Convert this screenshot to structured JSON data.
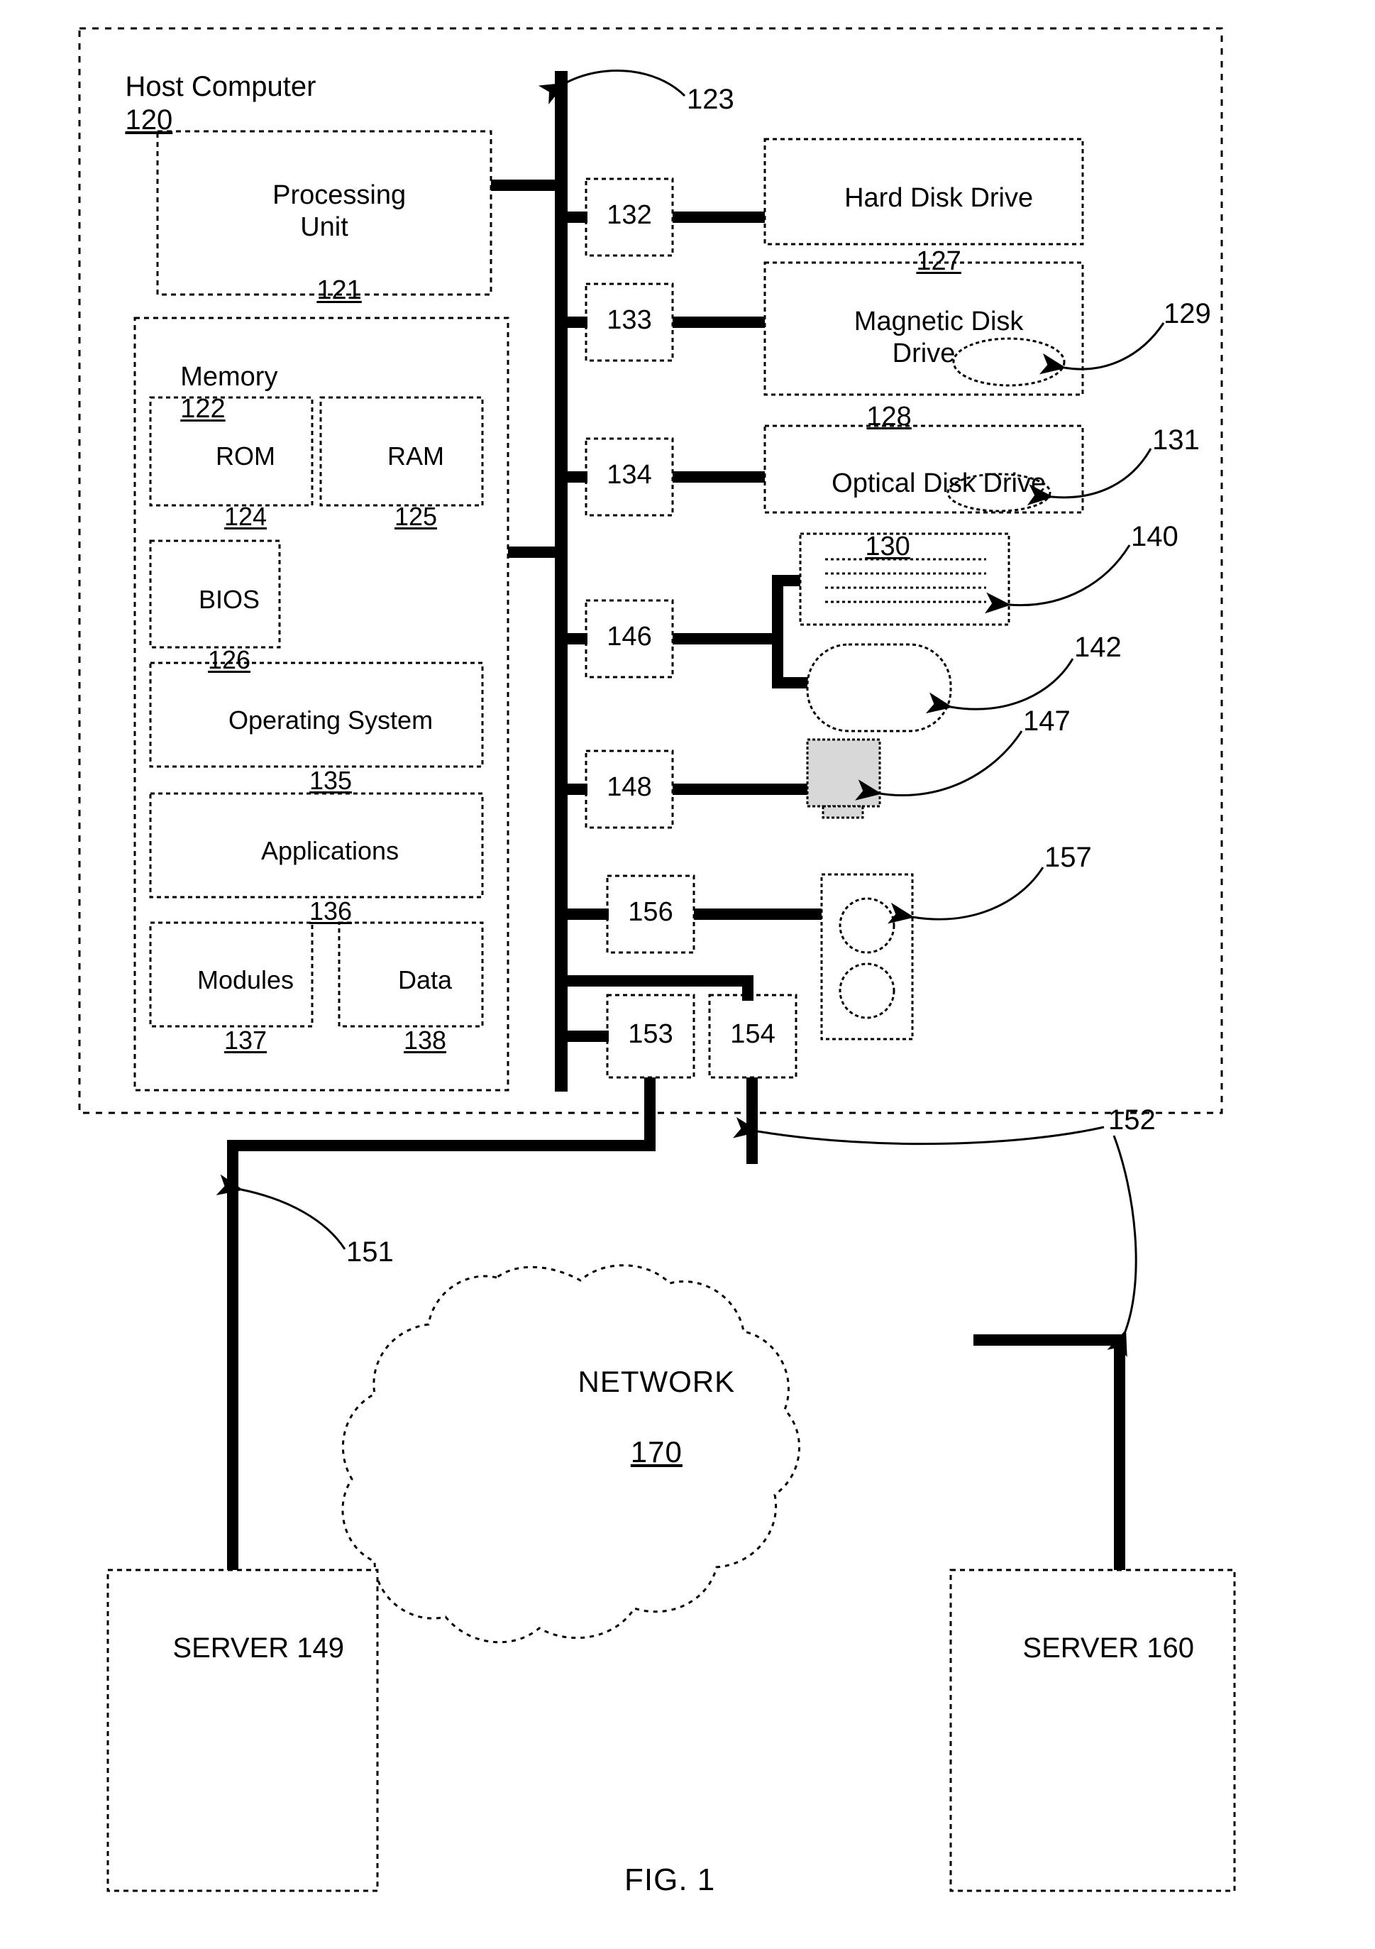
{
  "figure": {
    "caption": "FIG. 1",
    "host": {
      "title": "Host Computer",
      "ref": "120"
    },
    "blocks": {
      "processing_unit": {
        "label": "Processing\nUnit",
        "ref": "121"
      },
      "memory": {
        "label": "Memory",
        "ref": "122"
      },
      "rom": {
        "label": "ROM",
        "ref": "124"
      },
      "ram": {
        "label": "RAM",
        "ref": "125"
      },
      "bios": {
        "label": "BIOS",
        "ref": "126"
      },
      "operating_system": {
        "label": "Operating System",
        "ref": "135"
      },
      "applications": {
        "label": "Applications",
        "ref": "136"
      },
      "modules": {
        "label": "Modules",
        "ref": "137"
      },
      "data": {
        "label": "Data",
        "ref": "138"
      },
      "hard_disk_drive": {
        "label": "Hard Disk Drive",
        "ref": "127"
      },
      "magnetic_disk_drive": {
        "label": "Magnetic Disk\nDrive",
        "ref": "128"
      },
      "optical_disk_drive": {
        "label": "Optical Disk Drive",
        "ref": "130"
      },
      "network": {
        "label": "NETWORK",
        "ref": "170"
      },
      "server_left": {
        "label": "SERVER 149"
      },
      "server_right": {
        "label": "SERVER 160"
      }
    },
    "interfaces": {
      "i132": "132",
      "i133": "133",
      "i134": "134",
      "i146": "146",
      "i148": "148",
      "i156": "156",
      "i153": "153",
      "i154": "154"
    },
    "callouts": {
      "bus": "123",
      "magnetic_disk": "129",
      "optical_disk": "131",
      "keyboard": "140",
      "mouse": "142",
      "monitor": "147",
      "speakers": "157",
      "link_left": "151",
      "link_right": "152"
    }
  }
}
